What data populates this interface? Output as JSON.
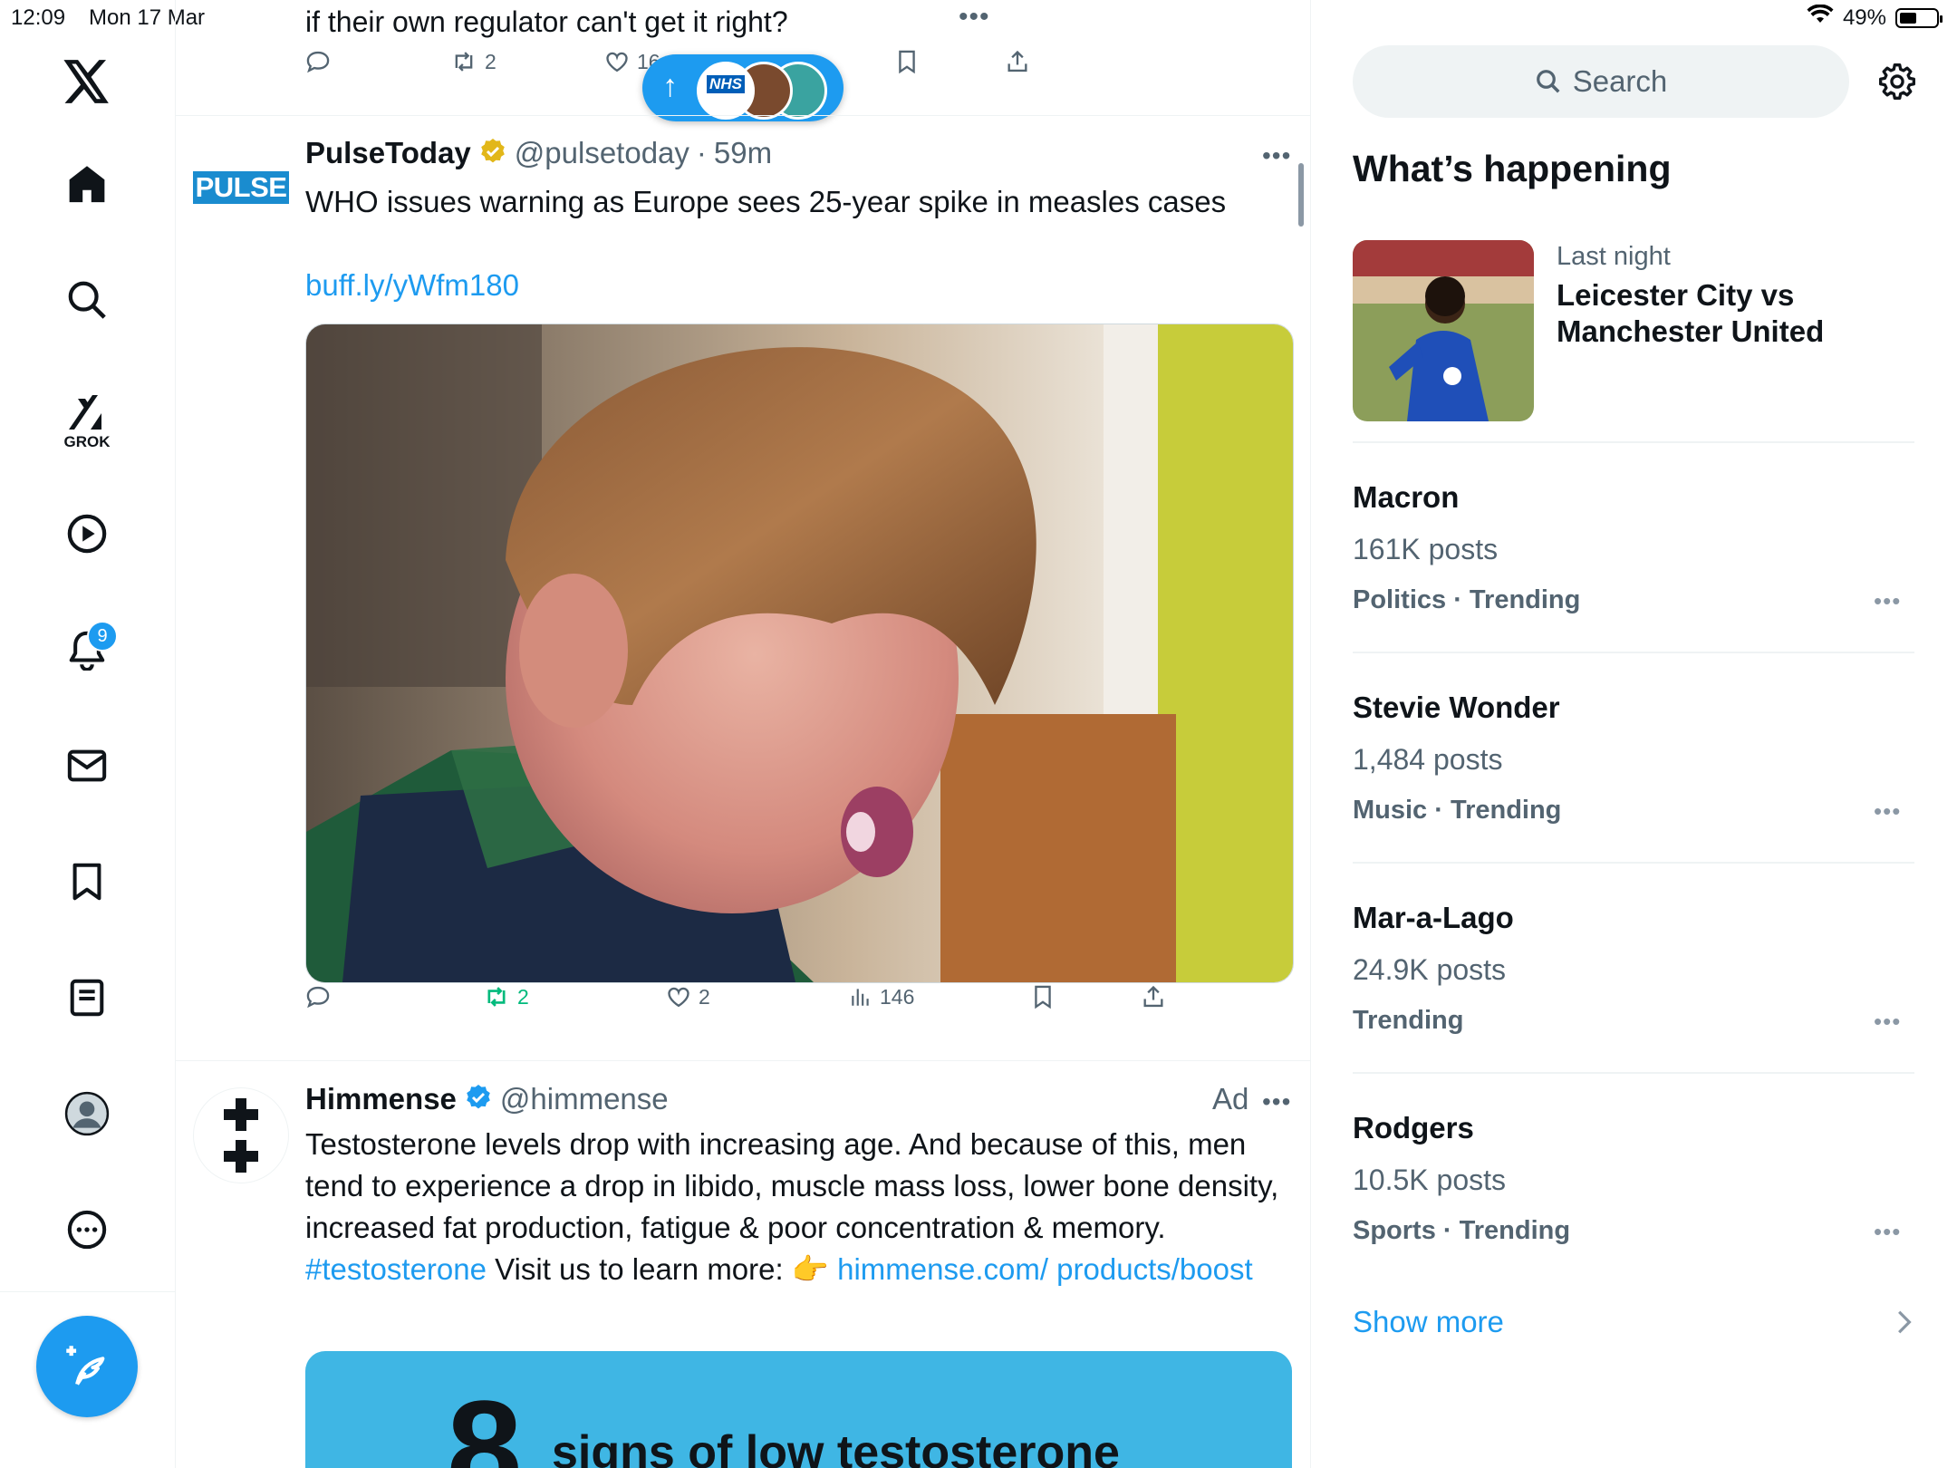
{
  "status_bar": {
    "time": "12:09",
    "date": "Mon 17 Mar",
    "battery": "49%"
  },
  "nav": {
    "grok_label": "GROK",
    "notifications_badge": "9"
  },
  "feed": {
    "prev_tweet": {
      "text": "if their own regulator can't get it right?",
      "retweets": "2",
      "likes": "16"
    },
    "new_posts_pill": {
      "arrow": "↑",
      "label_nhs": "NHS"
    },
    "tweet1": {
      "avatar_text": "PULSE",
      "name": "PulseToday",
      "handle": "@pulsetoday",
      "time": "59m",
      "text": "WHO issues warning as Europe sees 25-year spike in measles cases",
      "link": "buff.ly/yWfm180",
      "retweets": "2",
      "likes": "2",
      "views": "146"
    },
    "tweet2": {
      "name": "Himmense",
      "handle": "@himmense",
      "ad_label": "Ad",
      "text_part1": "Testosterone levels drop with increasing age. And because of this, men tend to experience a drop in libido, muscle mass loss, lower bone density, increased fat production, fatigue & poor concentration & memory.",
      "hashtag": "#testosterone",
      "text_part2": "Visit us to learn more: 👉",
      "link": "himmense.com/ products/boost",
      "card_number": "8",
      "card_text": "signs of low testosterone"
    }
  },
  "sidebar": {
    "search_placeholder": "Search",
    "title": "What’s happening",
    "featured": {
      "meta": "Last night",
      "title": "Leicester City vs Manchester United"
    },
    "trends": [
      {
        "name": "Macron",
        "posts": "161K posts",
        "category": "Politics · Trending"
      },
      {
        "name": "Stevie Wonder",
        "posts": "1,484 posts",
        "category": "Music · Trending"
      },
      {
        "name": "Mar-a-Lago",
        "posts": "24.9K posts",
        "category": "Trending"
      },
      {
        "name": "Rodgers",
        "posts": "10.5K posts",
        "category": "Sports · Trending"
      }
    ],
    "show_more": "Show more"
  },
  "colors": {
    "accent": "#1d9bf0",
    "retweet_green": "#00ba7c",
    "muted": "#536471"
  }
}
